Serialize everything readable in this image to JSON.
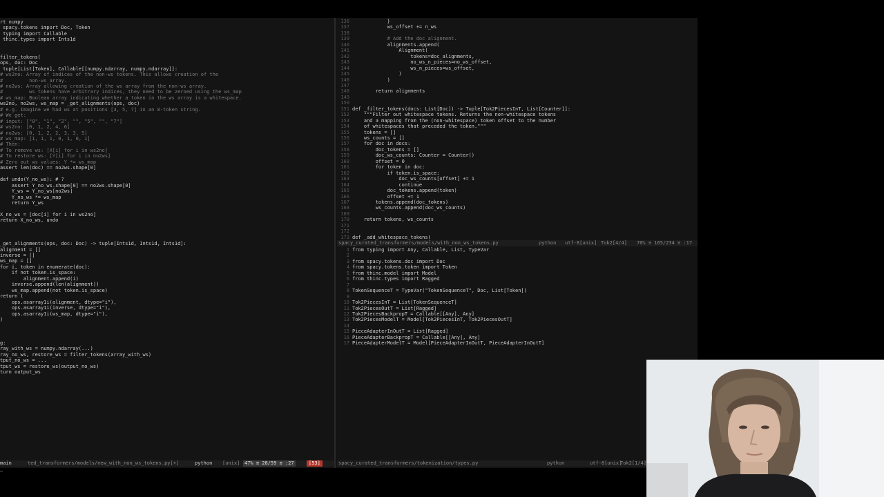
{
  "left_pane": {
    "lines": [
      "rt numpy",
      " spacy.tokens import Doc, Token",
      " typing import Callable",
      " thinc.types import Ints1d",
      "",
      "",
      "filter_tokens(",
      "ops, doc: Doc",
      " tuple[List[Token], Callable[[numpy.ndarray, numpy.ndarray]]:",
      "# ws2no: Array of indices of the non-ws tokens. This allows creation of the",
      "#         non-ws array.",
      "# no2ws: Array allowing creation of the ws array from the non-ws array.",
      "#         ws tokens have arbitrary indices, they need to be zeroed using the ws_map",
      "# ws_map: Boolean array indicating whether a token in the ws array is a whitespace.",
      "ws2no, no2ws, ws_map = _get_alignments(ops, doc)",
      "# e.g. Imagine we had ws at positions [3, 5, 7] in an 8-token string.",
      "# We get:",
      "# input: [\"0\", \"1\", \"2\", \"\", \"5\", \"\", \"7\"]",
      "# ws2no: [0, 1, 2, 4, 6]",
      "# no2ws: [0, 1, 2, 2, 3, 3, 5]",
      "# ws_map: [1, 1, 1, 0, 1, 0, 1]",
      "# Then:",
      "# To remove ws: [X[i] for i in ws2no]",
      "# To restore ws: [Y[i] for i in no2ws]",
      "# Zero out ws values: Y *= ws_map",
      "assert len(doc) == no2ws.shape[0]",
      "",
      "def undo(Y_no_ws): # ?",
      "    assert Y_no_ws.shape[0] == no2ws.shape[0]",
      "    Y_ws = Y_no_ws[no2ws]",
      "    Y_no_ws *= ws_map",
      "    return Y_ws",
      "",
      "X_no_ws = [doc[i] for i in ws2no]",
      "return X_no_ws, undo",
      "",
      "",
      "",
      "_get_alignments(ops, doc: Doc) -> tuple[Ints1d, Ints1d, Ints1d]:",
      "alignment = []",
      "inverse = []",
      "ws_map = []",
      "for i, token in enumerate(doc):",
      "    if not token.is_space:",
      "        alignment.append(i)",
      "    inverse.append(len(alignment))",
      "    ws_map.append(not token.is_space)",
      "return (",
      "    ops.asarray1i(alignment, dtype=\"i\"),",
      "    ops.asarray1i(inverse, dtype=\"i\"),",
      "    ops.asarray1i(ws_map, dtype=\"i\"),",
      ")",
      "",
      "",
      "",
      "g:",
      "ray_with_ws = numpy.ndarray(...)",
      "ray_no_ws, restore_ws = filter_tokens(array_with_ws)",
      "tput_no_ws = ...",
      "tput_ws = restore_ws(output_no_ws)",
      "turn output_ws"
    ]
  },
  "right_top": {
    "lines": [
      {
        "n": "136",
        "t": "            }"
      },
      {
        "n": "137",
        "t": "            ws_offset += n_ws"
      },
      {
        "n": "138",
        "t": ""
      },
      {
        "n": "139",
        "t": "            # Add the doc alignment."
      },
      {
        "n": "140",
        "t": "            alignments.append("
      },
      {
        "n": "141",
        "t": "                Alignment("
      },
      {
        "n": "142",
        "t": "                    tokens=doc_alignments,"
      },
      {
        "n": "143",
        "t": "                    no_ws_n_pieces=no_ws_offset,"
      },
      {
        "n": "144",
        "t": "                    ws_n_pieces=ws_offset,"
      },
      {
        "n": "145",
        "t": "                )"
      },
      {
        "n": "146",
        "t": "            )"
      },
      {
        "n": "147",
        "t": ""
      },
      {
        "n": "148",
        "t": "        return alignments"
      },
      {
        "n": "149",
        "t": ""
      },
      {
        "n": "150",
        "t": ""
      },
      {
        "n": "151",
        "t": "def _filter_tokens(docs: List[Doc]) -> Tuple[Tok2PiecesInT, List[Counter]]:"
      },
      {
        "n": "152",
        "t": "    \"\"\"Filter out whitespace tokens. Returns the non-whitespace tokens"
      },
      {
        "n": "153",
        "t": "    and a mapping from the (non-whitespace) token offset to the number"
      },
      {
        "n": "154",
        "t": "    of whitespaces that preceded the token.\"\"\""
      },
      {
        "n": "155",
        "t": "    tokens = []"
      },
      {
        "n": "156",
        "t": "    ws_counts = []"
      },
      {
        "n": "157",
        "t": "    for doc in docs:"
      },
      {
        "n": "158",
        "t": "        doc_tokens = []"
      },
      {
        "n": "159",
        "t": "        doc_ws_counts: Counter = Counter()"
      },
      {
        "n": "160",
        "t": "        offset = 0"
      },
      {
        "n": "161",
        "t": "        for token in doc:"
      },
      {
        "n": "162",
        "t": "            if token.is_space:"
      },
      {
        "n": "163",
        "t": "                doc_ws_counts[offset] += 1"
      },
      {
        "n": "164",
        "t": "                continue"
      },
      {
        "n": "165",
        "t": "            doc_tokens.append(token)"
      },
      {
        "n": "166",
        "t": "            offset += 1"
      },
      {
        "n": "167",
        "t": "        tokens.append(doc_tokens)"
      },
      {
        "n": "168",
        "t": "        ws_counts.append(doc_ws_counts)"
      },
      {
        "n": "169",
        "t": ""
      },
      {
        "n": "170",
        "t": "    return tokens, ws_counts"
      },
      {
        "n": "171",
        "t": ""
      },
      {
        "n": "172",
        "t": ""
      },
      {
        "n": "173",
        "t": "def _add_whitespace_tokens("
      }
    ],
    "status": {
      "file": "spacy_curated_transformers/models/with_non_ws_tokens.py",
      "filetype": "python",
      "encoding": "utf-8[unix]",
      "pos": "Tok2[4/4]",
      "percent": "70% ≡ 165/234 ≡ :17"
    }
  },
  "right_bottom": {
    "lines": [
      {
        "n": "1",
        "t": "from typing import Any, Callable, List, TypeVar"
      },
      {
        "n": "2",
        "t": ""
      },
      {
        "n": "3",
        "t": "from spacy.tokens.doc import Doc"
      },
      {
        "n": "4",
        "t": "from spacy.tokens.token import Token"
      },
      {
        "n": "5",
        "t": "from thinc.model import Model"
      },
      {
        "n": "6",
        "t": "from thinc.types import Ragged"
      },
      {
        "n": "7",
        "t": ""
      },
      {
        "n": "8",
        "t": "TokenSequenceT = TypeVar(\"TokenSequenceT\", Doc, List[Token])"
      },
      {
        "n": "9",
        "t": ""
      },
      {
        "n": "10",
        "t": "Tok2PiecesInT = List[TokenSequenceT]"
      },
      {
        "n": "11",
        "t": "Tok2PiecesOutT = List[Ragged]"
      },
      {
        "n": "12",
        "t": "Tok2PiecesBackpropT = Callable[[Any], Any]"
      },
      {
        "n": "13",
        "t": "Tok2PiecesModelT = Model[Tok2PiecesInT, Tok2PiecesOutT]"
      },
      {
        "n": "14",
        "t": ""
      },
      {
        "n": "15",
        "t": "PieceAdapterInOutT = List[Ragged]"
      },
      {
        "n": "16",
        "t": "PieceAdapterBackpropT = Callable[[Any], Any]"
      },
      {
        "n": "17",
        "t": "PieceAdapterModelT = Model[PieceAdapterInOutT, PieceAdapterInOutT]"
      }
    ],
    "status": {
      "file": "spacy_curated_transformers/tokenization/types.py",
      "filetype": "python",
      "encoding": "utf-8[unix]",
      "pos": "Tok2[1/4]"
    }
  },
  "left_status": {
    "mode": "main",
    "file": "ted_transformers/models/new_with_non_ws_tokens.py[+]",
    "filetype": "python",
    "encoding": "[unix]",
    "percent": "47% ≡ 28/59 ≡ :27",
    "error": "[53]"
  },
  "colors": {
    "background": "#141414",
    "keyword": "#e05a4a",
    "comment": "#7b7b7b",
    "highlight": "#e6a41f",
    "text": "#cfcfcf"
  },
  "webcam": {
    "icon": "person-video-feed"
  }
}
